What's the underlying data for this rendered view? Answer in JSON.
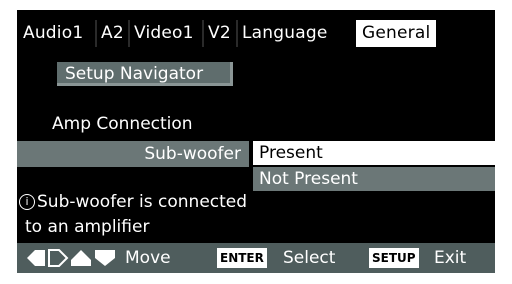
{
  "tabs": [
    {
      "label": "Audio1"
    },
    {
      "label": "A2"
    },
    {
      "label": "Video1"
    },
    {
      "label": "V2"
    },
    {
      "label": "Language"
    },
    {
      "label": "General",
      "active": true
    }
  ],
  "setup_navigator": {
    "label": "Setup Navigator"
  },
  "section": {
    "title": "Amp Connection"
  },
  "setting": {
    "label": "Sub-woofer",
    "options": [
      "Present",
      "Not Present"
    ],
    "selected": "Present"
  },
  "info": {
    "icon": "info-icon",
    "line1": "Sub-woofer is connected",
    "line2": "to an amplifier"
  },
  "footer": {
    "move_icon": "arrow-keys-icon",
    "move_label": "Move",
    "enter_key": "ENTER",
    "enter_label": "Select",
    "setup_key": "SETUP",
    "setup_label": "Exit"
  },
  "colors": {
    "background": "#000000",
    "highlight": "#6b7777",
    "selected": "#ffffff",
    "footer": "#4f5d5d"
  }
}
